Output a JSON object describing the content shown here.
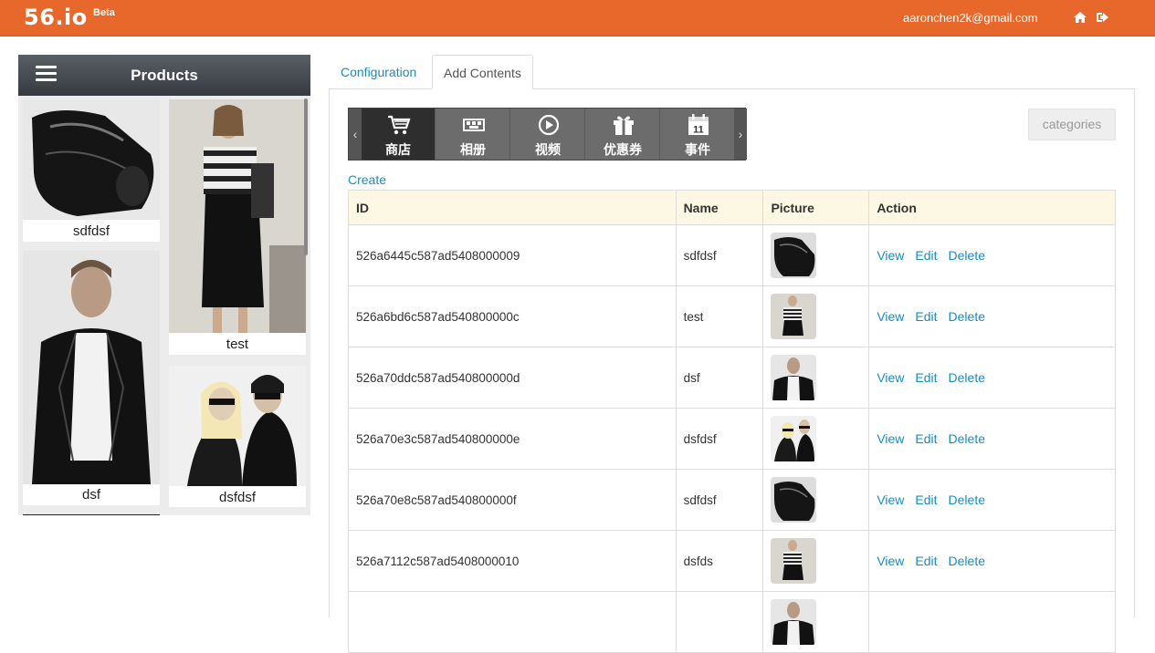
{
  "header": {
    "logo": "56.io",
    "beta": "Beta",
    "email": "aaronchen2k@gmail.com",
    "icons": [
      "home-icon",
      "logout-icon"
    ]
  },
  "products_panel": {
    "title": "Products",
    "items": [
      {
        "caption": "sdfdsf"
      },
      {
        "caption": "test"
      },
      {
        "caption": "dsf"
      },
      {
        "caption": "dsfdsf"
      }
    ]
  },
  "tabs": [
    {
      "label": "Configuration"
    },
    {
      "label": "Add Contents"
    }
  ],
  "toolbar": {
    "items": [
      {
        "label": "商店",
        "icon": "cart-icon"
      },
      {
        "label": "相册",
        "icon": "album-icon"
      },
      {
        "label": "视频",
        "icon": "play-icon"
      },
      {
        "label": "优惠券",
        "icon": "gift-icon"
      },
      {
        "label": "事件",
        "icon": "calendar-icon",
        "icon_text": "11"
      }
    ]
  },
  "categories_button": "categories",
  "create_link": "Create",
  "table": {
    "columns": [
      "ID",
      "Name",
      "Picture",
      "Action"
    ],
    "actions": [
      "View",
      "Edit",
      "Delete"
    ],
    "rows": [
      {
        "id": "526a6445c587ad5408000009",
        "name": "sdfdsf",
        "picture": "bag"
      },
      {
        "id": "526a6bd6c587ad540800000c",
        "name": "test",
        "picture": "dress"
      },
      {
        "id": "526a70ddc587ad540800000d",
        "name": "dsf",
        "picture": "man"
      },
      {
        "id": "526a70e3c587ad540800000e",
        "name": "dsfdsf",
        "picture": "couple"
      },
      {
        "id": "526a70e8c587ad540800000f",
        "name": "sdfdsf",
        "picture": "bag"
      },
      {
        "id": "526a7112c587ad5408000010",
        "name": "dsfds",
        "picture": "dress"
      },
      {
        "id": "",
        "name": "",
        "picture": "man"
      }
    ]
  },
  "colors": {
    "brand": "#e8672a",
    "link": "#1b8bbf",
    "table_header": "#fcf8e3"
  }
}
